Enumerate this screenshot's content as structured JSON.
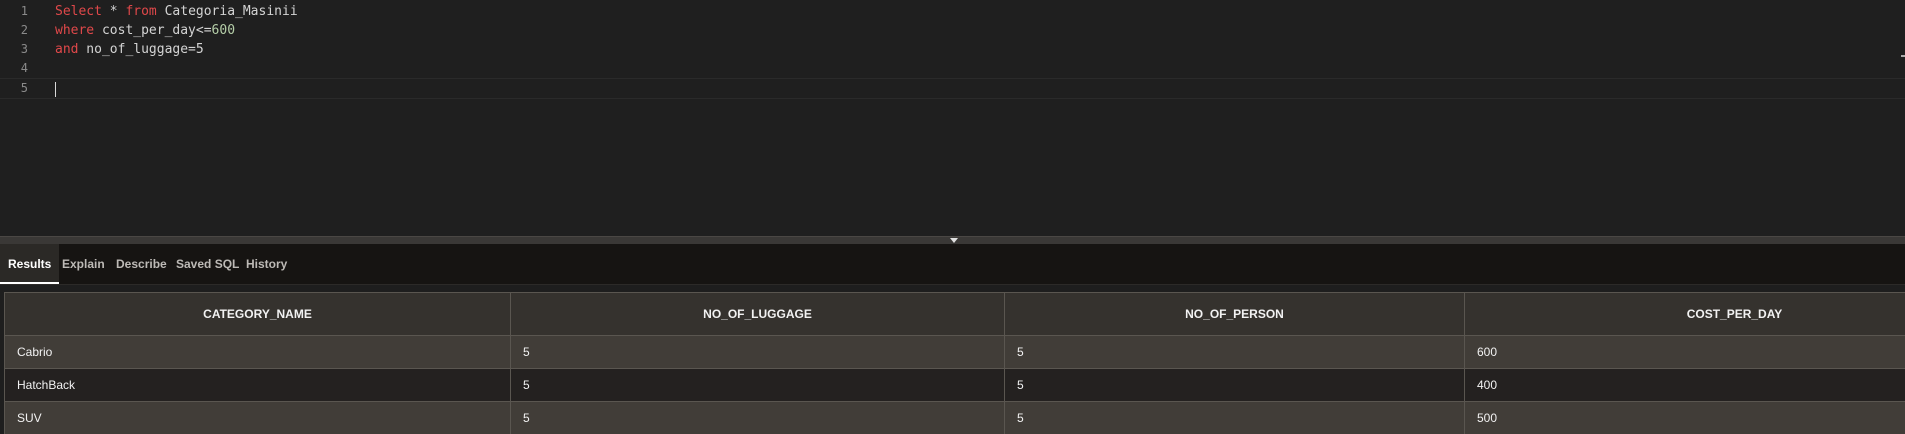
{
  "editor": {
    "lines": [
      {
        "n": "1",
        "tokens": [
          {
            "t": "Select",
            "c": "kw"
          },
          {
            "t": " * ",
            "c": ""
          },
          {
            "t": "from",
            "c": "kw"
          },
          {
            "t": " Categoria_Masinii",
            "c": ""
          }
        ]
      },
      {
        "n": "2",
        "tokens": [
          {
            "t": "where",
            "c": "kw"
          },
          {
            "t": " cost_per_day<=",
            "c": ""
          },
          {
            "t": "600",
            "c": "num"
          }
        ]
      },
      {
        "n": "3",
        "tokens": [
          {
            "t": "and",
            "c": "kw"
          },
          {
            "t": " no_of_luggage=5",
            "c": ""
          }
        ]
      },
      {
        "n": "4",
        "tokens": []
      },
      {
        "n": "5",
        "tokens": []
      }
    ]
  },
  "tabs": [
    {
      "label": "Results",
      "active": true
    },
    {
      "label": "Explain",
      "active": false
    },
    {
      "label": "Describe",
      "active": false
    },
    {
      "label": "Saved SQL",
      "active": false
    },
    {
      "label": "History",
      "active": false
    }
  ],
  "results": {
    "columns": [
      "CATEGORY_NAME",
      "NO_OF_LUGGAGE",
      "NO_OF_PERSON",
      "COST_PER_DAY"
    ],
    "rows": [
      [
        "Cabrio",
        "5",
        "5",
        "600"
      ],
      [
        "HatchBack",
        "5",
        "5",
        "400"
      ],
      [
        "SUV",
        "5",
        "5",
        "500"
      ]
    ]
  }
}
